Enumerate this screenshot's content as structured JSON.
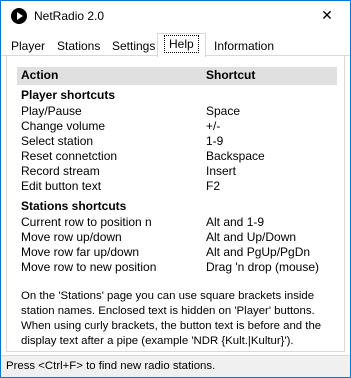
{
  "window": {
    "title": "NetRadio 2.0",
    "close_glyph": "✕"
  },
  "tabs": [
    {
      "label": "Player"
    },
    {
      "label": "Stations"
    },
    {
      "label": "Settings"
    },
    {
      "label": "Help",
      "active": true
    },
    {
      "label": "Information"
    }
  ],
  "help": {
    "columns": {
      "action": "Action",
      "shortcut": "Shortcut"
    },
    "player_section": {
      "title": "Player shortcuts",
      "rows": [
        {
          "action": "Play/Pause",
          "shortcut": "Space"
        },
        {
          "action": "Change volume",
          "shortcut": "+/-"
        },
        {
          "action": "Select station",
          "shortcut": "1-9"
        },
        {
          "action": "Reset connetction",
          "shortcut": "Backspace"
        },
        {
          "action": "Record stream",
          "shortcut": "Insert"
        },
        {
          "action": "Edit button text",
          "shortcut": "F2"
        }
      ]
    },
    "stations_section": {
      "title": "Stations shortcuts",
      "rows": [
        {
          "action": "Current row to position n",
          "shortcut": "Alt and 1-9"
        },
        {
          "action": "Move row up/down",
          "shortcut": "Alt and Up/Down"
        },
        {
          "action": "Move row far up/down",
          "shortcut": "Alt and PgUp/PgDn"
        },
        {
          "action": "Move row to new position",
          "shortcut": "Drag 'n drop (mouse)"
        }
      ]
    },
    "note": "On the 'Stations' page you can use square brackets inside station names. Enclosed text is hidden on 'Player' buttons. When using curly brackets, the button text is before and the display text after a pipe (example 'NDR {Kult.|Kultur}')."
  },
  "statusbar": {
    "text": "Press <Ctrl+F> to find new radio stations."
  }
}
